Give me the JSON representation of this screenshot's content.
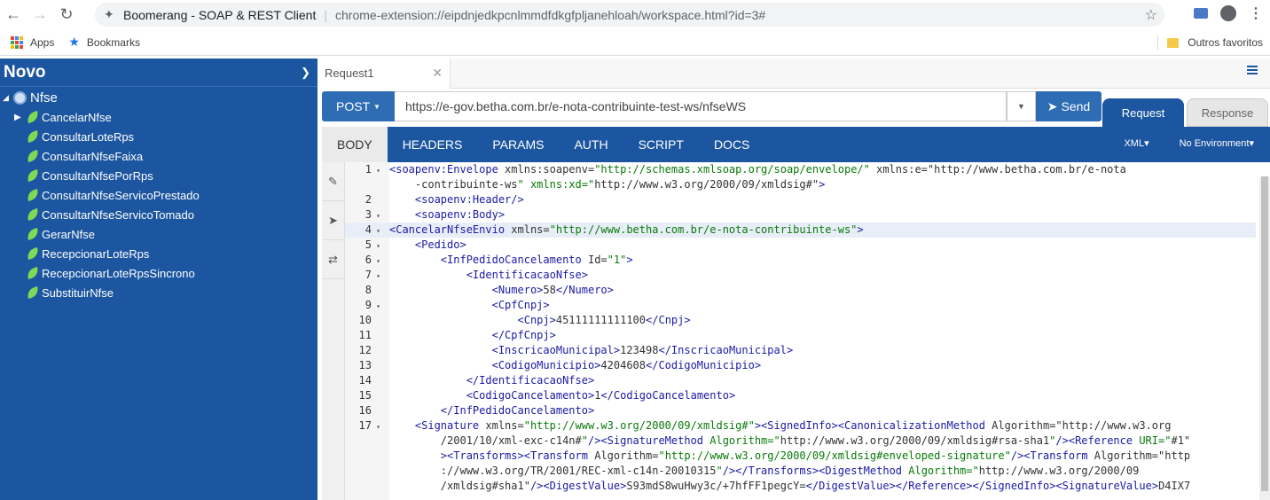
{
  "browser": {
    "tab_title": "Boomerang - SOAP & REST Client",
    "url": "chrome-extension://eipdnjedkpcnlmmdfdkgfpljanehloah/workspace.html?id=3#",
    "bookmarks": [
      "Apps",
      "Bookmarks"
    ],
    "other_bookmarks": "Outros favoritos"
  },
  "sidebar": {
    "title": "Novo",
    "root": "Nfse",
    "items": [
      {
        "label": "CancelarNfse",
        "expandable": true
      },
      {
        "label": "ConsultarLoteRps"
      },
      {
        "label": "ConsultarNfseFaixa"
      },
      {
        "label": "ConsultarNfsePorRps"
      },
      {
        "label": "ConsultarNfseServicoPrestado"
      },
      {
        "label": "ConsultarNfseServicoTomado"
      },
      {
        "label": "GerarNfse"
      },
      {
        "label": "RecepcionarLoteRps"
      },
      {
        "label": "RecepcionarLoteRpsSincrono"
      },
      {
        "label": "SubstituirNfse"
      }
    ]
  },
  "request": {
    "tab_label": "Request1",
    "method": "POST",
    "url": "https://e-gov.betha.com.br/e-nota-contribuinte-test-ws/nfseWS",
    "send_label": "Send",
    "rr_tabs": [
      "Request",
      "Response"
    ],
    "subtabs": [
      "BODY",
      "HEADERS",
      "PARAMS",
      "AUTH",
      "SCRIPT",
      "DOCS"
    ],
    "format": "XML",
    "environment": "No Environment"
  },
  "editor": {
    "lines": [
      {
        "n": "1",
        "fold": true,
        "text": "<soapenv:Envelope xmlns:soapenv=\"http://schemas.xmlsoap.org/soap/envelope/\" xmlns:e=\"http://www.betha.com.br/e-nota"
      },
      {
        "n": "",
        "fold": false,
        "text": "    -contribuinte-ws\" xmlns:xd=\"http://www.w3.org/2000/09/xmldsig#\">"
      },
      {
        "n": "2",
        "fold": false,
        "text": "    <soapenv:Header/>"
      },
      {
        "n": "3",
        "fold": true,
        "text": "    <soapenv:Body>"
      },
      {
        "n": "4",
        "fold": true,
        "text": "<CancelarNfseEnvio xmlns=\"http://www.betha.com.br/e-nota-contribuinte-ws\">",
        "active": true
      },
      {
        "n": "5",
        "fold": true,
        "text": "    <Pedido>"
      },
      {
        "n": "6",
        "fold": true,
        "text": "        <InfPedidoCancelamento Id=\"1\">"
      },
      {
        "n": "7",
        "fold": true,
        "text": "            <IdentificacaoNfse>"
      },
      {
        "n": "8",
        "fold": false,
        "text": "                <Numero>58</Numero>"
      },
      {
        "n": "9",
        "fold": true,
        "text": "                <CpfCnpj>"
      },
      {
        "n": "10",
        "fold": false,
        "text": "                    <Cnpj>45111111111100</Cnpj>"
      },
      {
        "n": "11",
        "fold": false,
        "text": "                </CpfCnpj>"
      },
      {
        "n": "12",
        "fold": false,
        "text": "                <InscricaoMunicipal>123498</InscricaoMunicipal>"
      },
      {
        "n": "13",
        "fold": false,
        "text": "                <CodigoMunicipio>4204608</CodigoMunicipio>"
      },
      {
        "n": "14",
        "fold": false,
        "text": "            </IdentificacaoNfse>"
      },
      {
        "n": "15",
        "fold": false,
        "text": "            <CodigoCancelamento>1</CodigoCancelamento>"
      },
      {
        "n": "16",
        "fold": false,
        "text": "        </InfPedidoCancelamento>"
      },
      {
        "n": "17",
        "fold": true,
        "text": "    <Signature xmlns=\"http://www.w3.org/2000/09/xmldsig#\"><SignedInfo><CanonicalizationMethod Algorithm=\"http://www.w3.org"
      },
      {
        "n": "",
        "fold": false,
        "text": "        /2001/10/xml-exc-c14n#\"/><SignatureMethod Algorithm=\"http://www.w3.org/2000/09/xmldsig#rsa-sha1\"/><Reference URI=\"#1\""
      },
      {
        "n": "",
        "fold": false,
        "text": "        ><Transforms><Transform Algorithm=\"http://www.w3.org/2000/09/xmldsig#enveloped-signature\"/><Transform Algorithm=\"http"
      },
      {
        "n": "",
        "fold": false,
        "text": "        ://www.w3.org/TR/2001/REC-xml-c14n-20010315\"/></Transforms><DigestMethod Algorithm=\"http://www.w3.org/2000/09"
      },
      {
        "n": "",
        "fold": false,
        "text": "        /xmldsig#sha1\"/><DigestValue>S93mdS8wuHwy3c/+7hfFF1pegcY=</DigestValue></Reference></SignedInfo><SignatureValue>D4IX7"
      }
    ]
  },
  "colors": {
    "accent": "#1c56a0",
    "button": "#2e6db4"
  }
}
